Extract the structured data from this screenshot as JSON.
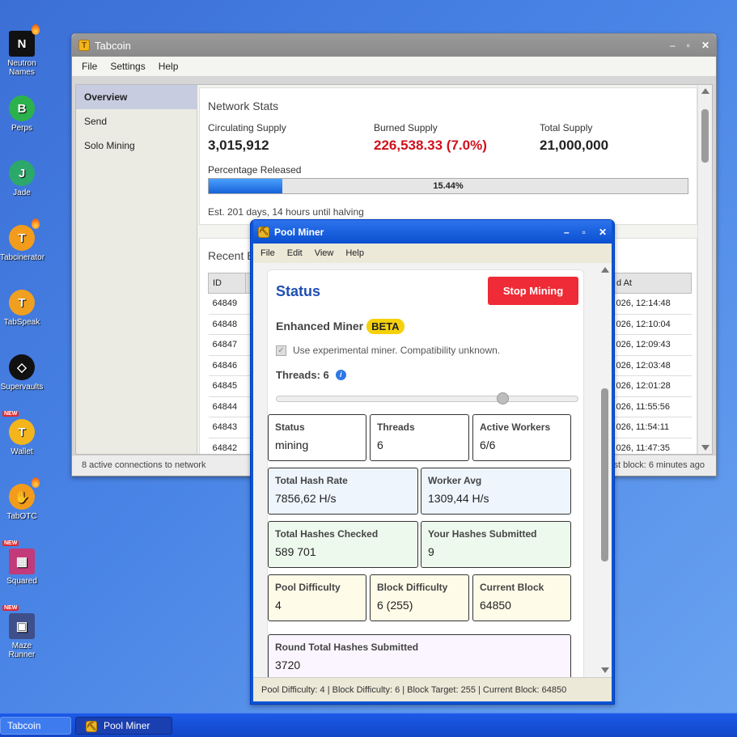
{
  "desktop": {
    "icons": [
      {
        "label": "Neutron Names",
        "new": false,
        "flame": true,
        "color": "#111111",
        "glyph": "N"
      },
      {
        "label": "Perps",
        "new": false,
        "flame": false,
        "color": "#2bb24c",
        "glyph": "B"
      },
      {
        "label": "Jade",
        "new": false,
        "flame": false,
        "color": "#2ca86a",
        "glyph": "J"
      },
      {
        "label": "Tabcinerator",
        "new": false,
        "flame": true,
        "color": "#f39c1b",
        "glyph": "T"
      },
      {
        "label": "TabSpeak",
        "new": false,
        "flame": false,
        "color": "#f0a020",
        "glyph": "T"
      },
      {
        "label": "Supervaults",
        "new": false,
        "flame": false,
        "color": "#111111",
        "glyph": "◇"
      },
      {
        "label": "Wallet",
        "new": true,
        "flame": false,
        "color": "#f3b51b",
        "glyph": "T"
      },
      {
        "label": "TabOTC",
        "new": false,
        "flame": true,
        "color": "#f39c1b",
        "glyph": "✋"
      },
      {
        "label": "Squared",
        "new": true,
        "flame": false,
        "color": "#c23a7a",
        "glyph": "▦"
      },
      {
        "label": "Maze Runner",
        "new": true,
        "flame": false,
        "color": "#3f4f8a",
        "glyph": "▣"
      }
    ],
    "new_badge": "NEW"
  },
  "tabcoin": {
    "title": "Tabcoin",
    "menu": [
      "File",
      "Settings",
      "Help"
    ],
    "sidebar": [
      "Overview",
      "Send",
      "Solo Mining"
    ],
    "network": {
      "heading": "Network Stats",
      "circulating_label": "Circulating Supply",
      "circulating_value": "3,015,912",
      "burned_label": "Burned Supply",
      "burned_value": "226,538.33 (7.0%)",
      "total_label": "Total Supply",
      "total_value": "21,000,000",
      "released_label": "Percentage Released",
      "released_pct": "15.44%",
      "released_fraction": 0.1544,
      "halving": "Est. 201 days, 14 hours until halving"
    },
    "recent": {
      "heading": "Recent B",
      "columns": [
        "ID",
        "d At"
      ],
      "rows": [
        {
          "id": "64849",
          "at": "026, 12:14:48"
        },
        {
          "id": "64848",
          "at": "026, 12:10:04"
        },
        {
          "id": "64847",
          "at": "026, 12:09:43"
        },
        {
          "id": "64846",
          "at": "026, 12:03:48"
        },
        {
          "id": "64845",
          "at": "026, 12:01:28"
        },
        {
          "id": "64844",
          "at": "026, 11:55:56"
        },
        {
          "id": "64843",
          "at": "026, 11:54:11"
        },
        {
          "id": "64842",
          "at": "026, 11:47:35"
        }
      ]
    },
    "status_left": "8 active connections to network",
    "status_right": "st block: 6 minutes ago"
  },
  "pool": {
    "title": "Pool Miner",
    "menu": [
      "File",
      "Edit",
      "View",
      "Help"
    ],
    "status_title": "Status",
    "stop_label": "Stop Mining",
    "enhanced_label": "Enhanced Miner",
    "beta_label": "BETA",
    "experimental_label": "Use experimental miner. Compatibility unknown.",
    "threads_label": "Threads: 6",
    "threads_value": 6,
    "threads_max": 8,
    "metrics": {
      "status": {
        "label": "Status",
        "value": "mining"
      },
      "threads": {
        "label": "Threads",
        "value": "6"
      },
      "workers": {
        "label": "Active Workers",
        "value": "6/6"
      },
      "hashrate": {
        "label": "Total Hash Rate",
        "value": "7856,62 H/s"
      },
      "worker_avg": {
        "label": "Worker Avg",
        "value": "1309,44 H/s"
      },
      "hashes_checked": {
        "label": "Total Hashes Checked",
        "value": "589 701"
      },
      "hashes_submitted": {
        "label": "Your Hashes Submitted",
        "value": "9"
      },
      "pool_diff": {
        "label": "Pool Difficulty",
        "value": "4"
      },
      "block_diff": {
        "label": "Block Difficulty",
        "value": "6 (255)"
      },
      "current_block": {
        "label": "Current Block",
        "value": "64850"
      },
      "round_total": {
        "label": "Round Total Hashes Submitted",
        "value": "3720"
      }
    },
    "statusbar": "Pool Difficulty: 4 | Block Difficulty: 6 | Block Target: 255 | Current Block: 64850"
  },
  "taskbar": {
    "items": [
      "Tabcoin",
      "Pool Miner"
    ]
  },
  "colors": {
    "accent": "#1f4fb3",
    "burned": "#d0111b",
    "stop": "#ee2b36"
  }
}
